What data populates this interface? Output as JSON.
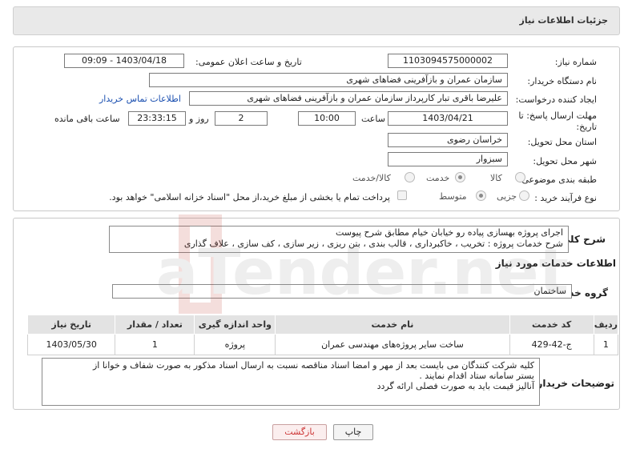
{
  "header": {
    "title": "جزئیات اطلاعات نیاز"
  },
  "form": {
    "need_number_label": "شماره نیاز:",
    "need_number": "1103094575000002",
    "announce_label": "تاریخ و ساعت اعلان عمومی:",
    "announce_value": "1403/04/18 - 09:09",
    "buyer_org_label": "نام دستگاه خریدار:",
    "buyer_org": "سازمان عمران و بازآفرینی فضاهای شهری",
    "creator_label": "ایجاد کننده درخواست:",
    "creator": "علیرضا باقری تبار کارپرداز سازمان عمران و بازآفرینی فضاهای شهری",
    "contact_link": "اطلاعات تماس خریدار",
    "deadline_label": "مهلت ارسال پاسخ: تا تاریخ:",
    "deadline_date": "1403/04/21",
    "time_label": "ساعت",
    "deadline_time": "10:00",
    "days_value": "2",
    "days_label": "روز و",
    "remaining_value": "23:33:15",
    "remaining_label": "ساعت باقی مانده",
    "province_label": "استان محل تحویل:",
    "province": "خراسان رضوی",
    "city_label": "شهر محل تحویل:",
    "city": "سبزوار",
    "category_label": "طبقه بندی موضوعی:",
    "category_options": [
      "کالا",
      "خدمت",
      "کالا/خدمت"
    ],
    "category_selected": "خدمت",
    "process_label": "نوع فرآیند خرید :",
    "process_options": [
      "جزیی",
      "متوسط"
    ],
    "process_selected": "متوسط",
    "treasury_note": "پرداخت تمام یا بخشی از مبلغ خرید،از محل \"اسناد خزانه اسلامی\" خواهد بود."
  },
  "summary": {
    "label": "شرح کلی نیاز:",
    "line1": "اجرای پروژه بهسازی پیاده رو خیابان خیام مطابق شرح پیوست",
    "line2": "شرح خدمات پروژه : تخریب ، خاکبرداری ، قالب بندی ، بتن ریزی ، زیر سازی ، کف سازی ، علاف گذاری"
  },
  "services": {
    "section_title": "اطلاعات خدمات مورد نیاز",
    "group_label": "گروه خدمت:",
    "group_value": "ساختمان",
    "columns": [
      "ردیف",
      "کد خدمت",
      "نام خدمت",
      "واحد اندازه گیری",
      "تعداد / مقدار",
      "تاریخ نیاز"
    ],
    "rows": [
      [
        "1",
        "ج-42-429",
        "ساخت سایر پروژه‌های مهندسی عمران",
        "پروژه",
        "1",
        "1403/05/30"
      ]
    ]
  },
  "buyer_notes": {
    "label": "توضیحات خریدار:",
    "line1": "کلیه شرکت کنندگان می بایست بعد از مهر و امضا اسناد مناقصه  نسبت به ارسال اسناد مذکور به صورت شفاف و خوانا از",
    "line2": "بستر سامانه ستاد اقدام نمایند .",
    "line3": "آنالیز قیمت باید به صورت فصلی ارائه گردد"
  },
  "buttons": {
    "print": "چاپ",
    "back": "بازگشت"
  },
  "watermark": {
    "text": "AriaTender.net"
  }
}
